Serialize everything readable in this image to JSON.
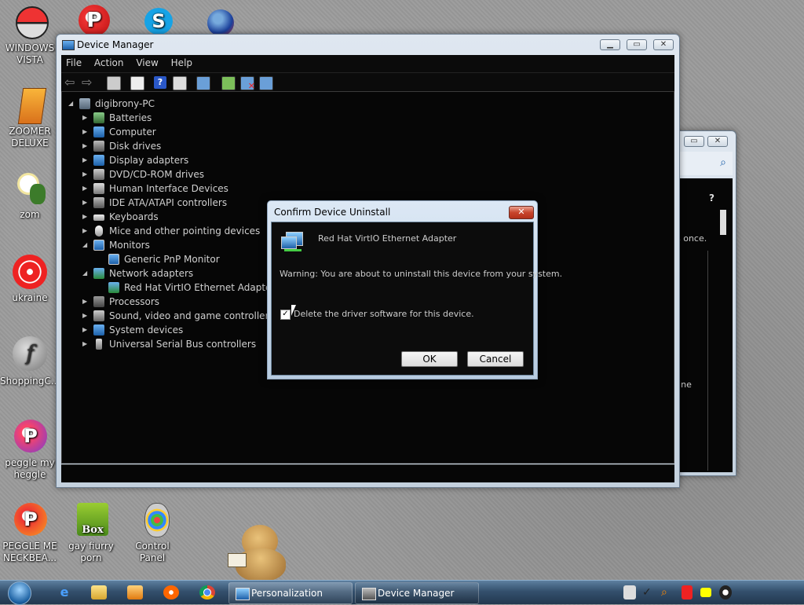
{
  "desktop": {
    "icons": [
      {
        "label": "WINDOWS VISTA"
      },
      {
        "label": "ZOOMER DELUXE"
      },
      {
        "label": "zom"
      },
      {
        "label": "ukraine"
      },
      {
        "label": "ShoppingC..."
      },
      {
        "label": "peggle my heggle"
      },
      {
        "label": "PEGGLE ME NECKBEA..."
      },
      {
        "label": "gay fiurry porn"
      },
      {
        "label": "Control Panel"
      }
    ]
  },
  "background_window": {
    "text1": "s once.",
    "text2": "line"
  },
  "device_manager": {
    "title": "Device Manager",
    "menu": [
      "File",
      "Action",
      "View",
      "Help"
    ],
    "tree": {
      "root": "digibrony-PC",
      "items": [
        {
          "label": "Batteries",
          "expanded": false
        },
        {
          "label": "Computer",
          "expanded": false
        },
        {
          "label": "Disk drives",
          "expanded": false
        },
        {
          "label": "Display adapters",
          "expanded": false
        },
        {
          "label": "DVD/CD-ROM drives",
          "expanded": false
        },
        {
          "label": "Human Interface Devices",
          "expanded": false
        },
        {
          "label": "IDE ATA/ATAPI controllers",
          "expanded": false
        },
        {
          "label": "Keyboards",
          "expanded": false
        },
        {
          "label": "Mice and other pointing devices",
          "expanded": false
        },
        {
          "label": "Monitors",
          "expanded": true
        },
        {
          "label": "Generic PnP Monitor",
          "child": true
        },
        {
          "label": "Network adapters",
          "expanded": true
        },
        {
          "label": "Red Hat VirtIO Ethernet Adapter",
          "child": true
        },
        {
          "label": "Processors",
          "expanded": false
        },
        {
          "label": "Sound, video and game controllers",
          "expanded": false
        },
        {
          "label": "System devices",
          "expanded": false
        },
        {
          "label": "Universal Serial Bus controllers",
          "expanded": false
        }
      ]
    }
  },
  "dialog": {
    "title": "Confirm Device Uninstall",
    "device_name": "Red Hat VirtIO Ethernet Adapter",
    "warning": "Warning: You are about to uninstall this device from your system.",
    "checkbox_label": "Delete the driver software for this device.",
    "checkbox_checked": true,
    "ok_label": "OK",
    "cancel_label": "Cancel"
  },
  "taskbar": {
    "buttons": [
      {
        "label": "Personalization"
      },
      {
        "label": "Device Manager"
      }
    ]
  },
  "colors": {
    "window_chrome": "#c4d1de",
    "content_bg": "#060606",
    "close_red": "#c8452c",
    "taskbar": "#34506d"
  }
}
